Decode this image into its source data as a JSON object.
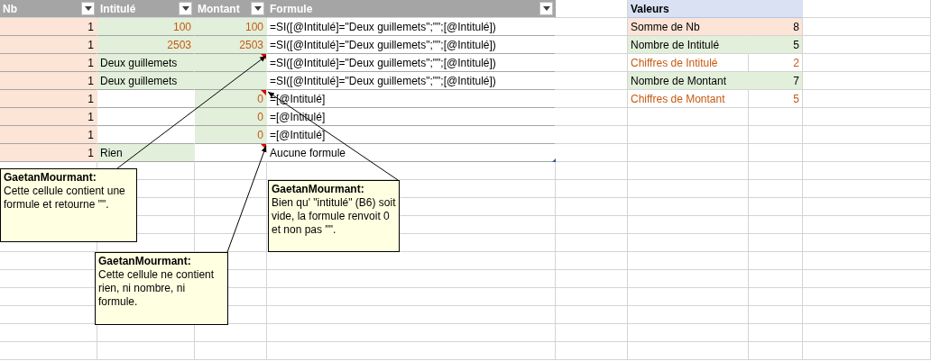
{
  "table": {
    "columns": [
      "Nb",
      "Intitulé",
      "Montant",
      "Formule"
    ],
    "rows": [
      {
        "cells": [
          {
            "text": "1",
            "kind": "number",
            "color": "#fce4d6",
            "comment": false
          },
          {
            "text": "100",
            "kind": "result",
            "color": "#e2efda",
            "comment": false
          },
          {
            "text": "100",
            "kind": "result",
            "color": "#e2efda",
            "comment": false
          },
          {
            "text": "=SI([@Intitulé]=\"Deux guillemets\";\"\";[@Intitulé])",
            "kind": "text",
            "color": "#ffffff",
            "comment": false
          }
        ]
      },
      {
        "cells": [
          {
            "text": "1",
            "kind": "number",
            "color": "#fce4d6",
            "comment": false
          },
          {
            "text": "2503",
            "kind": "result",
            "color": "#e2efda",
            "comment": false
          },
          {
            "text": "2503",
            "kind": "result",
            "color": "#e2efda",
            "comment": false
          },
          {
            "text": "=SI([@Intitulé]=\"Deux guillemets\";\"\";[@Intitulé])",
            "kind": "text",
            "color": "#ffffff",
            "comment": false
          }
        ]
      },
      {
        "cells": [
          {
            "text": "1",
            "kind": "number",
            "color": "#fce4d6",
            "comment": false
          },
          {
            "text": "Deux guillemets",
            "kind": "text",
            "color": "#e2efda",
            "comment": false
          },
          {
            "kind": "result",
            "color": "#e2efda",
            "comment": true
          },
          {
            "text": "=SI([@Intitulé]=\"Deux guillemets\";\"\";[@Intitulé])",
            "kind": "text",
            "color": "#ffffff",
            "comment": false
          }
        ]
      },
      {
        "cells": [
          {
            "text": "1",
            "kind": "number",
            "color": "#fce4d6",
            "comment": false
          },
          {
            "text": "Deux guillemets",
            "kind": "text",
            "color": "#e2efda",
            "comment": false
          },
          {
            "kind": "result",
            "color": "#e2efda",
            "comment": false
          },
          {
            "text": "=SI([@Intitulé]=\"Deux guillemets\";\"\";[@Intitulé])",
            "kind": "text",
            "color": "#ffffff",
            "comment": false
          }
        ]
      },
      {
        "cells": [
          {
            "text": "1",
            "kind": "number",
            "color": "#fce4d6",
            "comment": false
          },
          {
            "kind": "text",
            "color": "#ffffff",
            "comment": false
          },
          {
            "text": "0",
            "kind": "result",
            "color": "#e2efda",
            "comment": true
          },
          {
            "text": "=[@Intitulé]",
            "kind": "text",
            "color": "#ffffff",
            "comment": false
          }
        ]
      },
      {
        "cells": [
          {
            "text": "1",
            "kind": "number",
            "color": "#fce4d6",
            "comment": false
          },
          {
            "kind": "text",
            "color": "#ffffff",
            "comment": false
          },
          {
            "text": "0",
            "kind": "result",
            "color": "#e2efda",
            "comment": false
          },
          {
            "text": "=[@Intitulé]",
            "kind": "text",
            "color": "#ffffff",
            "comment": false
          }
        ]
      },
      {
        "cells": [
          {
            "text": "1",
            "kind": "number",
            "color": "#fce4d6",
            "comment": false
          },
          {
            "kind": "text",
            "color": "#ffffff",
            "comment": false
          },
          {
            "text": "0",
            "kind": "result",
            "color": "#e2efda",
            "comment": false
          },
          {
            "text": "=[@Intitulé]",
            "kind": "text",
            "color": "#ffffff",
            "comment": false
          }
        ]
      },
      {
        "cells": [
          {
            "text": "1",
            "kind": "number",
            "color": "#fce4d6",
            "comment": false
          },
          {
            "text": "Rien",
            "kind": "text",
            "color": "#e2efda",
            "comment": false
          },
          {
            "kind": "result",
            "color": "#ffffff",
            "comment": true
          },
          {
            "text": "Aucune formule",
            "kind": "text",
            "color": "#ffffff",
            "comment": false
          }
        ]
      }
    ]
  },
  "pivot": {
    "header": "Valeurs",
    "rows": [
      {
        "label": "Somme de Nb",
        "value": "8",
        "kind": "total",
        "color": "#fce4d6"
      },
      {
        "label": "Nombre de Intitulé",
        "value": "5",
        "kind": "total",
        "color": "#e2efda"
      },
      {
        "label": "Chiffres de Intitulé",
        "value": "2",
        "kind": "digits",
        "color": "#ffffff"
      },
      {
        "label": "Nombre de Montant",
        "value": "7",
        "kind": "total",
        "color": "#e2efda"
      },
      {
        "label": "Chiffres de Montant",
        "value": "5",
        "kind": "digits",
        "color": "#ffffff"
      }
    ]
  },
  "comments": [
    {
      "author": "GaetanMourmant:",
      "text": "Cette cellule contient une formule et retourne \"\"."
    },
    {
      "author": "GaetanMourmant:",
      "text": "Cette cellule ne contient rien, ni nombre, ni formule."
    },
    {
      "author": "GaetanMourmant:",
      "text": "Bien qu' \"intitulé\" (B6) soit vide, la formule renvoit 0 et non pas \"\"."
    }
  ]
}
